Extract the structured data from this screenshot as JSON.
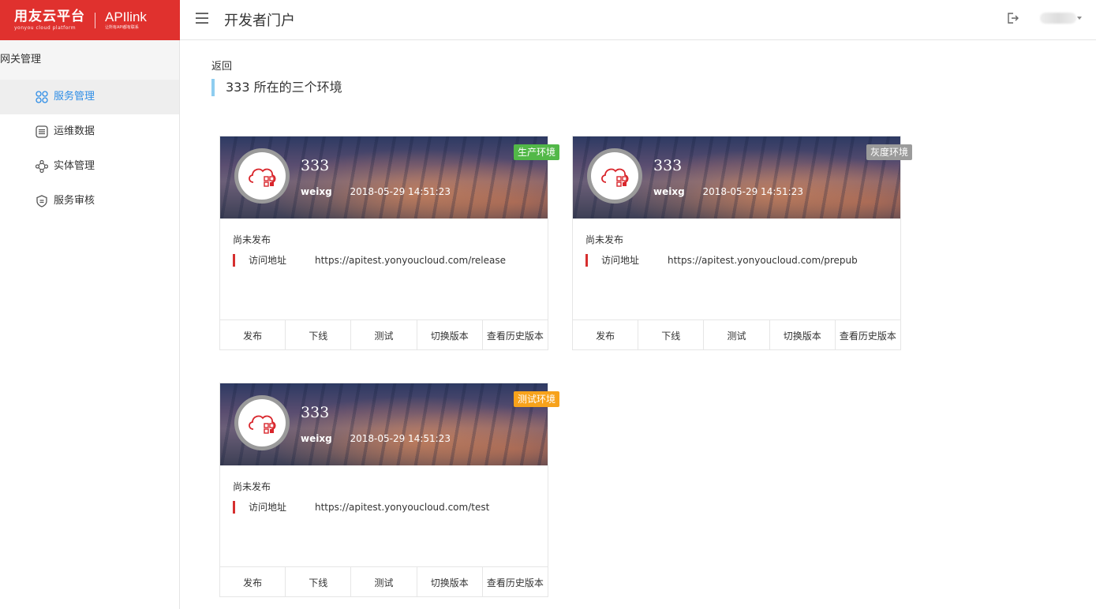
{
  "brand": {
    "name": "用友云平台",
    "name_en": "yonyou cloud platform",
    "product": "APIlink",
    "product_sub": "让所有API都有联系"
  },
  "header": {
    "title": "开发者门户"
  },
  "sidebar": {
    "group": "网关管理",
    "items": [
      {
        "label": "服务管理",
        "icon": "grid-icon",
        "active": true
      },
      {
        "label": "运维数据",
        "icon": "list-icon",
        "active": false
      },
      {
        "label": "实体管理",
        "icon": "nodes-icon",
        "active": false
      },
      {
        "label": "服务审核",
        "icon": "shield-icon",
        "active": false
      }
    ]
  },
  "main": {
    "back": "返回",
    "title": "333 所在的三个环境",
    "cards": [
      {
        "name": "333",
        "user": "weixg",
        "time": "2018-05-29 14:51:23",
        "env": "生产环境",
        "env_color": "#52b848",
        "status": "尚未发布",
        "addr_label": "访问地址",
        "addr": "https://apitest.yonyoucloud.com/release"
      },
      {
        "name": "333",
        "user": "weixg",
        "time": "2018-05-29 14:51:23",
        "env": "灰度环境",
        "env_color": "#9b9b9b",
        "status": "尚未发布",
        "addr_label": "访问地址",
        "addr": "https://apitest.yonyoucloud.com/prepub"
      },
      {
        "name": "333",
        "user": "weixg",
        "time": "2018-05-29 14:51:23",
        "env": "测试环境",
        "env_color": "#f7a21b",
        "status": "尚未发布",
        "addr_label": "访问地址",
        "addr": "https://apitest.yonyoucloud.com/test"
      }
    ],
    "actions": [
      "发布",
      "下线",
      "测试",
      "切换版本",
      "查看历史版本"
    ]
  },
  "colors": {
    "brand": "#e0312e",
    "active_text": "#2f8ee6",
    "accent_bar": "#8ecdf0",
    "addr_bar": "#d62f2f"
  }
}
